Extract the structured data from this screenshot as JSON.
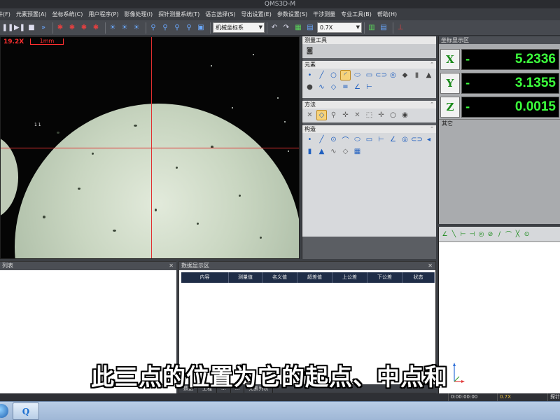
{
  "window": {
    "title": "QMS3D-M"
  },
  "menu": [
    "件(F)",
    "元素预置(A)",
    "坐标系统(C)",
    "用户程序(P)",
    "影像处理(I)",
    "探针测量系统(T)",
    "语言选择(S)",
    "导出设置(E)",
    "参数设置(S)",
    "干涉测量",
    "专业工具(B)",
    "帮助(H)"
  ],
  "toolbar": {
    "coord_system": "机械坐标系",
    "zoom": "0.7X"
  },
  "camera": {
    "magnification": "19.2X",
    "scale_label": "1mm",
    "tiny_label": "1 1"
  },
  "measure_panel": {
    "title": "测量工具",
    "elements_title": "元素",
    "method_title": "方法",
    "construct_title": "构造"
  },
  "coord_panel": {
    "title": "坐标显示区",
    "axes": [
      {
        "axis": "X",
        "sign": "-",
        "value": "5.2336"
      },
      {
        "axis": "Y",
        "sign": "-",
        "value": "3.1355"
      },
      {
        "axis": "Z",
        "sign": "-",
        "value": "0.0015"
      }
    ],
    "others_label": "其它"
  },
  "left_panel": {
    "title": "列表"
  },
  "data_panel": {
    "title": "数据显示区",
    "columns": [
      "内容",
      "测量值",
      "名义值",
      "超差值",
      "上公差",
      "下公差",
      "状态"
    ],
    "tabs": [
      "数据",
      "工程",
      "...",
      "...",
      "元素列表"
    ]
  },
  "status": {
    "time": "0:00:00:00",
    "zoom": "0.7X",
    "probe": "探针"
  },
  "subtitle": "此三点的位置为它的起点、中点和",
  "taskbar": {
    "app_label": "Q"
  }
}
